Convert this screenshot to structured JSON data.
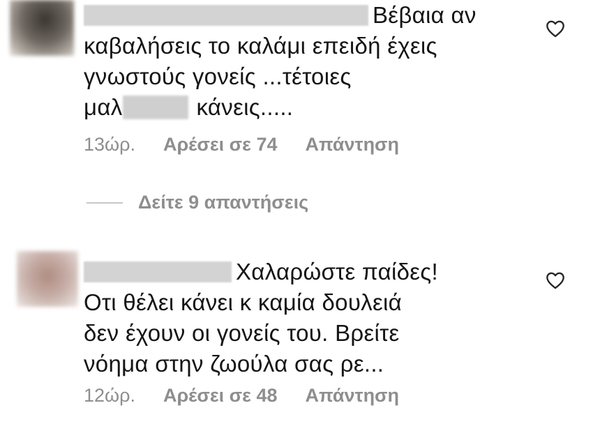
{
  "comments": [
    {
      "text_line1": "Βέβαια αν",
      "text_line2": "καβαλήσεις το καλάμι επειδή έχεις",
      "text_line3": "γνωστούς γονείς ...τέτοιες",
      "text_line4_start": "μαλ",
      "text_line4_end": "κάνεις.....",
      "time": "13ώρ.",
      "likes_label": "Αρέσει σε 74",
      "reply_label": "Απάντηση",
      "like_icon": "heart-outline-icon"
    },
    {
      "text_line1": "Χαλαρώστε παίδες!",
      "text_line2": "Οτι θέλει κάνει κ καμία δουλειά",
      "text_line3": "δεν έχουν οι γονείς του. Βρείτε",
      "text_line4": "νόημα στην ζωούλα σας ρε...",
      "time": "12ώρ.",
      "likes_label": "Αρέσει σε 48",
      "reply_label": "Απάντηση",
      "like_icon": "heart-outline-icon"
    }
  ],
  "view_replies": {
    "label": "Δείτε 9 απαντήσεις"
  },
  "colors": {
    "text": "#151515",
    "meta": "#8e8e8e",
    "divider": "#c7c7c7",
    "background": "#ffffff"
  }
}
